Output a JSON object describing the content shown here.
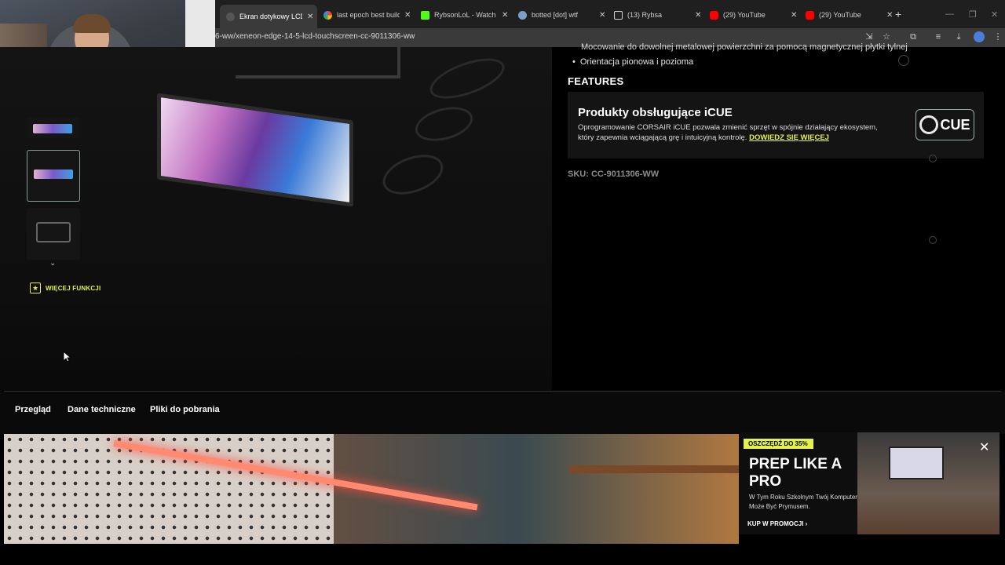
{
  "browser": {
    "tabs": [
      {
        "label": "Ekran dotykowy LCD",
        "icon": "corsair-sail-icon",
        "active": true
      },
      {
        "label": "last epoch best build",
        "icon": "google-icon"
      },
      {
        "label": "RybsonLoL - Watch c",
        "icon": "kick-icon"
      },
      {
        "label": "botted [dot] wtf",
        "icon": "site-icon"
      },
      {
        "label": "(13) Rybsa",
        "icon": "x-icon"
      },
      {
        "label": "(29) YouTube",
        "icon": "youtube-icon"
      },
      {
        "label": "(29) YouTube",
        "icon": "youtube-icon"
      }
    ],
    "url": "6-ww/xeneon-edge-14-5-lcd-touchscreen-cc-9011306-ww"
  },
  "product": {
    "bullet_cut": "Mocowanie do dowolnej metalowej powierzchni za pomocą magnetycznej płytki tylnej",
    "bullet": "Orientacja pionowa i pozioma",
    "features_heading": "FEATURES",
    "icue": {
      "title": "Produkty obsługujące iCUE",
      "desc": "Oprogramowanie CORSAIR iCUE pozwala zmienić sprzęt w spójnie działający ekosystem, który zapewnia wciągającą grę i intuicyjną kontrolę.",
      "link": "DOWIEDZ SIĘ WIĘCEJ",
      "logo": "CUE"
    },
    "sku": "SKU: CC-9011306-WW",
    "more_features": "WIĘCEJ FUNKCJI"
  },
  "section_tabs": [
    "Przegląd",
    "Dane techniczne",
    "Pliki do pobrania"
  ],
  "promo": {
    "badge": "OSZCZĘDŹ DO 35%",
    "title": "PREP LIKE A PRO",
    "subtitle": "W Tym Roku Szkolnym Twój Komputer Może Być Prymusem.",
    "cta": "KUP W PROMOCJI ›",
    "close": "✕"
  },
  "colors": {
    "accent": "#e2f24a",
    "background": "#000000",
    "card": "#141414"
  }
}
